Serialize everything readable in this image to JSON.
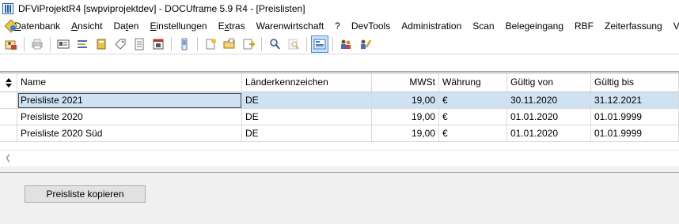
{
  "window": {
    "title": "DFViProjektR4 [swpviprojektdev] - DOCUframe 5.9 R4 - [Preislisten]"
  },
  "menu": [
    {
      "pre": "",
      "u": "D",
      "post": "atenbank"
    },
    {
      "pre": "",
      "u": "A",
      "post": "nsicht"
    },
    {
      "pre": "Da",
      "u": "t",
      "post": "en"
    },
    {
      "pre": "",
      "u": "E",
      "post": "instellungen"
    },
    {
      "pre": "E",
      "u": "x",
      "post": "tras"
    },
    {
      "pre": "Warenwirtschaft",
      "u": "",
      "post": ""
    },
    {
      "pre": "?",
      "u": "",
      "post": ""
    },
    {
      "pre": "DevTools",
      "u": "",
      "post": ""
    },
    {
      "pre": "Administration",
      "u": "",
      "post": ""
    },
    {
      "pre": "Scan",
      "u": "",
      "post": ""
    },
    {
      "pre": "Belegeingang",
      "u": "",
      "post": ""
    },
    {
      "pre": "RBF",
      "u": "",
      "post": ""
    },
    {
      "pre": "Zeiterfassung",
      "u": "",
      "post": ""
    },
    {
      "pre": "Ve",
      "u": "",
      "post": ""
    }
  ],
  "table": {
    "columns": [
      "Name",
      "Länderkennzeichen",
      "MWSt",
      "Währung",
      "Gültig von",
      "Gültig bis"
    ],
    "rows": [
      [
        "Preisliste 2021",
        "DE",
        "19,00",
        "€",
        "30.11.2020",
        "31.12.2021"
      ],
      [
        "Preisliste 2020",
        "DE",
        "19,00",
        "€",
        "01.01.2020",
        "01.01.9999"
      ],
      [
        "Preisliste 2020 Süd",
        "DE",
        "19,00",
        "€",
        "01.01.2020",
        "01.01.9999"
      ]
    ],
    "selected_row": 0
  },
  "actions": {
    "copy_label": "Preisliste kopieren"
  },
  "icons": [
    "app-icon",
    "system-menu-icon",
    "user-card-icon",
    "print-icon",
    "id-card-icon",
    "list-icon",
    "book-icon",
    "document-icon",
    "tag-icon",
    "calendar-icon",
    "phone-icon",
    "new-document-icon",
    "open-folder-icon",
    "export-icon",
    "search-icon",
    "search-disabled-icon",
    "view-toggle-icon",
    "users-icon",
    "user-edit-icon"
  ]
}
